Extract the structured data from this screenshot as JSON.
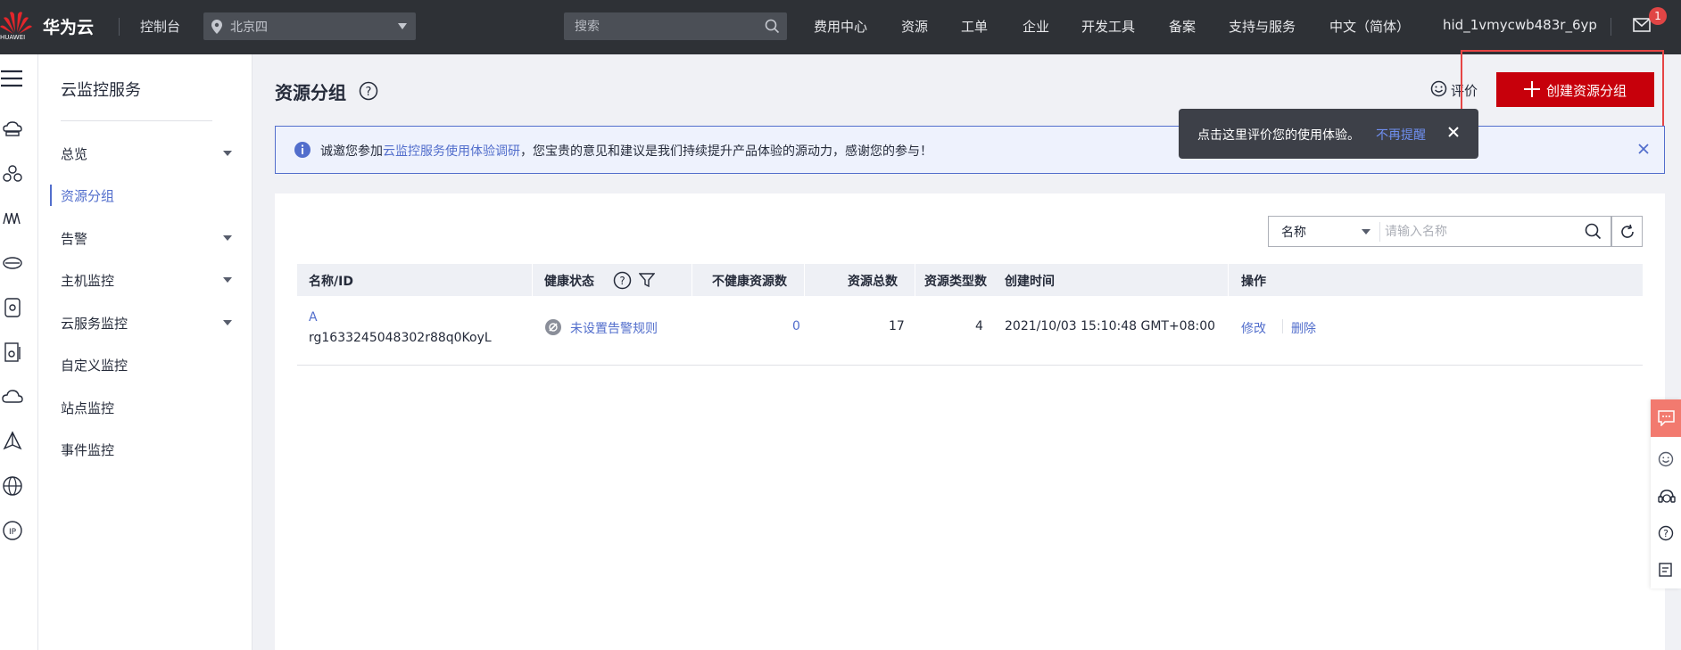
{
  "topnav": {
    "logo_text": "HUAWEI",
    "brand": "华为云",
    "console": "控制台",
    "region": "北京四",
    "search_placeholder": "搜索",
    "links": [
      "费用中心",
      "资源",
      "工单",
      "企业",
      "开发工具",
      "备案",
      "支持与服务",
      "中文（简体）",
      "hid_1vmycwb483r_6yp"
    ],
    "mail_badge": "1"
  },
  "rail_icons": [
    "cloud-server-icon",
    "cluster-icon",
    "network-icon",
    "database-icon",
    "storage-icon",
    "security-icon",
    "cloud-icon",
    "deploy-icon",
    "globe-icon",
    "ip-icon"
  ],
  "sidebar": {
    "title": "云监控服务",
    "items": [
      {
        "label": "总览",
        "expandable": true
      },
      {
        "label": "资源分组",
        "active": true
      },
      {
        "label": "告警",
        "expandable": true
      },
      {
        "label": "主机监控",
        "expandable": true
      },
      {
        "label": "云服务监控",
        "expandable": true
      },
      {
        "label": "自定义监控"
      },
      {
        "label": "站点监控"
      },
      {
        "label": "事件监控"
      }
    ]
  },
  "main": {
    "title": "资源分组",
    "rate_label": "评价",
    "create_button": "创建资源分组",
    "notice": {
      "prefix": "诚邀您参加",
      "link": "云监控服务使用体验调研",
      "suffix": "，您宝贵的意见和建议是我们持续提升产品体验的源动力，感谢您的参与！"
    },
    "tooltip": {
      "text": "点击这里评价您的使用体验。",
      "link": "不再提醒"
    },
    "filter": {
      "selected": "名称",
      "placeholder": "请输入名称"
    },
    "table": {
      "headers": [
        "名称/ID",
        "健康状态",
        "不健康资源数",
        "资源总数",
        "资源类型数",
        "创建时间",
        "操作"
      ],
      "rows": [
        {
          "name": "A",
          "id": "rg1633245048302r88q0KoyL",
          "health": "未设置告警规则",
          "unhealthy": "0",
          "total": "17",
          "types": "4",
          "created": "2021/10/03 15:10:48 GMT+08:00",
          "actions": [
            "修改",
            "删除"
          ]
        }
      ]
    }
  },
  "colors": {
    "nav_bg": "#2e3136",
    "primary_red": "#c7000b",
    "link_blue": "#526ecc",
    "highlight_box": "#e64545"
  }
}
